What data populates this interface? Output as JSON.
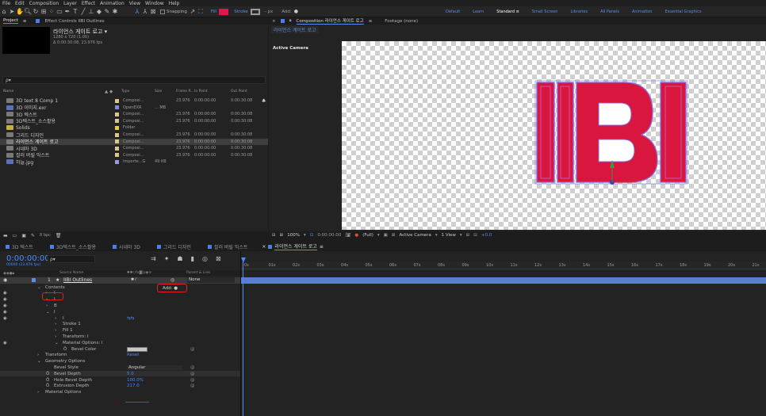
{
  "menu": [
    "File",
    "Edit",
    "Composition",
    "Layer",
    "Effect",
    "Animation",
    "View",
    "Window",
    "Help"
  ],
  "toolbar": {
    "snapping": "Snapping",
    "fill": "Fill",
    "stroke": "Stroke",
    "stroke_px": "- px",
    "add": "Add:",
    "workspaces": [
      "Default",
      "Learn",
      "Standard",
      "Small Screen",
      "Libraries",
      "All Panels",
      "Animation",
      "Essential Graphics"
    ],
    "active_workspace": "Standard",
    "colors": {
      "fill": "#e0164d",
      "accent": "#4d8bff"
    }
  },
  "project": {
    "tab": "Project",
    "effect_tab": "Effect Controls IIBI Outlines",
    "comp_name": "라이언스 게이트 로고 ▾",
    "comp_info1": "1280 x 720 (1.00)",
    "comp_info2": "Δ 0:00:30:08, 23.976 fps",
    "search_placeholder": "ρ▾",
    "columns": [
      "Name",
      "Type",
      "Size",
      "Frame R...",
      "In Point",
      "Out Point"
    ],
    "items": [
      {
        "name": "3D text 8 Comp 1",
        "type": "Composi...",
        "size": "",
        "fps": "23.976",
        "in": "0:00:00:00",
        "out": "0:00:30:08",
        "color": "#d8c890",
        "icon": "comp"
      },
      {
        "name": "3D 이미지.exr",
        "type": "OpenEXR",
        "size": "... MB",
        "fps": "",
        "in": "",
        "out": "",
        "color": "#8a8ad0",
        "icon": "file"
      },
      {
        "name": "3D 텍스트",
        "type": "Composi...",
        "size": "",
        "fps": "23.976",
        "in": "0:00:00:00",
        "out": "0:00:30:08",
        "color": "#d8c890",
        "icon": "comp"
      },
      {
        "name": "3D텍스트_소스활용",
        "type": "Composi...",
        "size": "",
        "fps": "23.976",
        "in": "0:00:00:00",
        "out": "0:00:30:08",
        "color": "#d8c890",
        "icon": "comp"
      },
      {
        "name": "Solids",
        "type": "Folder",
        "size": "",
        "fps": "",
        "in": "",
        "out": "",
        "color": "#e8d030",
        "icon": "folder"
      },
      {
        "name": "그리드 디자인",
        "type": "Composi...",
        "size": "",
        "fps": "23.976",
        "in": "0:00:00:00",
        "out": "0:00:30:08",
        "color": "#d8c890",
        "icon": "comp"
      },
      {
        "name": "라이언스 게이트 로고",
        "type": "Composi...",
        "size": "",
        "fps": "23.976",
        "in": "0:00:00:00",
        "out": "0:00:30:08",
        "color": "#d8c890",
        "icon": "comp",
        "selected": true
      },
      {
        "name": "시네마 3D",
        "type": "Composi...",
        "size": "",
        "fps": "23.976",
        "in": "0:00:00:00",
        "out": "0:00:30:08",
        "color": "#d8c890",
        "icon": "comp"
      },
      {
        "name": "컬러 버릴 믹스트",
        "type": "Composi...",
        "size": "",
        "fps": "23.976",
        "in": "0:00:00:00",
        "out": "0:00:30:08",
        "color": "#d8c890",
        "icon": "comp"
      },
      {
        "name": "하늘.jpg",
        "type": "Importe...G",
        "size": "49 KB",
        "fps": "",
        "in": "",
        "out": "",
        "color": "#9a9ad8",
        "icon": "file"
      }
    ],
    "bpc": "8 bpc"
  },
  "composition": {
    "tab": "Composition 라이언스 게이트 로고",
    "footage_tab": "Footage (none)",
    "sub_tab": "라이언스 게이트 로고",
    "camera_label": "Active Camera",
    "logo_text": "IIBI",
    "logo_color": "#d8163e",
    "footer": {
      "zoom": "100%",
      "timecode": "0:00:00:00",
      "quality": "(Full)",
      "camera": "Active Camera",
      "views": "1 View",
      "exposure": "+0.0"
    }
  },
  "timeline": {
    "tabs": [
      "3D 텍스트",
      "3D텍스트_소스활용",
      "시네마 3D",
      "그리드 디자인",
      "컬러 버릴 믹스트",
      "라이언스 게이트 로고"
    ],
    "active_tab": "라이언스 게이트 로고",
    "timecode": "0:00:00:00",
    "timecode_sub": "00000 (23.976 fps)",
    "search_placeholder": "ρ▾",
    "header_source": "Source Name",
    "header_parent": "Parent & Link",
    "layer_num": "1",
    "layer_name": "IIBI Outlines",
    "parent": "None",
    "add_label": "Add:",
    "reset": "Reset",
    "rows": [
      {
        "label": "Contents",
        "indent": 1,
        "value": ""
      },
      {
        "label": "I",
        "indent": 2,
        "value": ""
      },
      {
        "label": "I",
        "indent": 2,
        "value": ""
      },
      {
        "label": "B",
        "indent": 2,
        "value": ""
      },
      {
        "label": "I",
        "indent": 2,
        "value": ""
      },
      {
        "label": "I",
        "indent": 3,
        "value": ""
      },
      {
        "label": "Stroke 1",
        "indent": 3,
        "value": ""
      },
      {
        "label": "Fill 1",
        "indent": 3,
        "value": ""
      },
      {
        "label": "Transform: I",
        "indent": 3,
        "value": ""
      },
      {
        "label": "Material Options: I",
        "indent": 3,
        "value": ""
      },
      {
        "label": "Bevel Color",
        "indent": 4,
        "value": ""
      },
      {
        "label": "Transform",
        "indent": 1,
        "value": "Reset"
      },
      {
        "label": "Geometry Options",
        "indent": 1,
        "value": ""
      },
      {
        "label": "Bevel Style",
        "indent": 2,
        "value": "Angular"
      },
      {
        "label": "Bevel Depth",
        "indent": 2,
        "value": "5.0"
      },
      {
        "label": "Hole Bevel Depth",
        "indent": 2,
        "value": "100.0%"
      },
      {
        "label": "Extrusion Depth",
        "indent": 2,
        "value": "217.0"
      },
      {
        "label": "Material Options",
        "indent": 1,
        "value": ""
      }
    ],
    "ruler": [
      "0s",
      "01s",
      "02s",
      "03s",
      "04s",
      "05s",
      "06s",
      "07s",
      "08s",
      "09s",
      "10s",
      "11s",
      "12s",
      "13s",
      "14s",
      "15s",
      "16s",
      "17s",
      "18s",
      "19s",
      "20s",
      "21s"
    ]
  }
}
